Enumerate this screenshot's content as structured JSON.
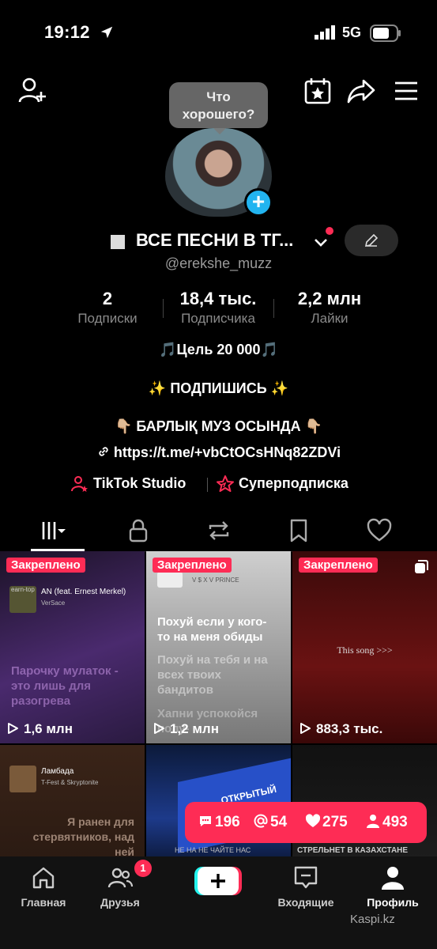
{
  "status_bar": {
    "time": "19:12",
    "network": "5G"
  },
  "tooltip": {
    "text": "Что хорошего?"
  },
  "profile": {
    "name": "ВСЕ ПЕСНИ В ТГ...",
    "handle": "@erekshe_muzz"
  },
  "stats": [
    {
      "value": "2",
      "label": "Подписки"
    },
    {
      "value": "18,4 тыс.",
      "label": "Подписчика"
    },
    {
      "value": "2,2 млн",
      "label": "Лайки"
    }
  ],
  "bio": {
    "line1": "🎵Цель 20 000🎵",
    "line2": "✨ ПОДПИШИСЬ ✨",
    "line3": "👇🏼 БАРЛЫҚ МУЗ ОСЫНДА 👇🏼",
    "link": "https://t.me/+vbCtOCsHNq82ZDVi"
  },
  "links": {
    "studio": "TikTok Studio",
    "super": "Суперподписка"
  },
  "videos": [
    {
      "pinned": "Закреплено",
      "views": "1,6 млн",
      "music_title": "AN (feat. Ernest Merkel)",
      "music_artist": "VerSace",
      "tag": "earn-top",
      "lyric": "Парочку мулаток - это лишь для разогрева"
    },
    {
      "pinned": "Закреплено",
      "views": "1,2 млн",
      "music_title": "V $ X V PRINCE",
      "lyric_bold": "Похуй если у кого-то на меня обиды",
      "lyric_faded": "Похуй на тебя и на всех твоих бандитов",
      "lyric_faded2": "Хапни успокойся полу-"
    },
    {
      "pinned": "Закреплено",
      "views": "883,3 тыс.",
      "caption": "This song >>>"
    },
    {
      "music_title": "Ламбада",
      "music_artist": "T-Fest & Skryptonite",
      "lyric": "Я ранен для стервятников, над ней"
    },
    {
      "sign_text": "ОТКРЫТЫЙ",
      "bottom_text": "НЕ НА НЕ ЧАЙТЕ НАС"
    },
    {
      "bottom_text": "СТРЕЛЬНЕТ В КАЗАХСТАНЕ"
    }
  ],
  "insights": {
    "comments": "196",
    "mentions": "54",
    "likes": "275",
    "followers": "493"
  },
  "nav": {
    "home": "Главная",
    "friends": "Друзья",
    "friends_badge": "1",
    "inbox": "Входящие",
    "profile": "Профиль"
  },
  "watermark": "Kaspi.kz",
  "colors": {
    "accent": "#fe2c55",
    "plus": "#22b4f0"
  }
}
